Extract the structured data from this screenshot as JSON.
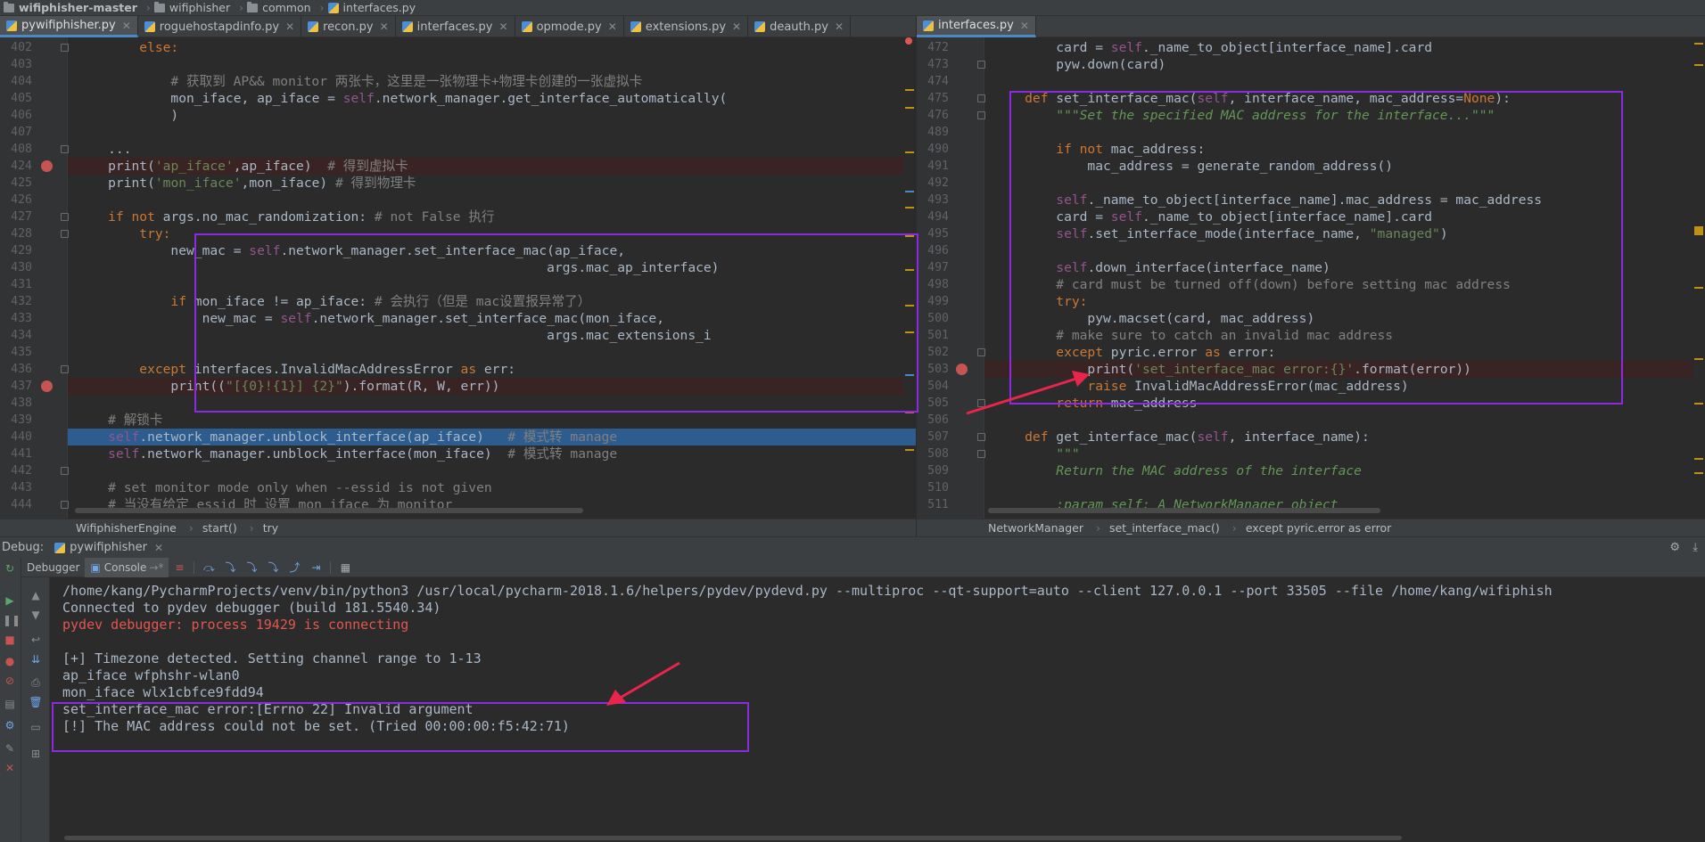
{
  "breadcrumb": [
    "wifiphisher-master",
    "wifiphisher",
    "common",
    "interfaces.py"
  ],
  "left_tabs": [
    {
      "label": "pywifiphisher.py",
      "active": true
    },
    {
      "label": "roguehostapdinfo.py",
      "active": false
    },
    {
      "label": "recon.py",
      "active": false
    },
    {
      "label": "interfaces.py",
      "active": false
    },
    {
      "label": "opmode.py",
      "active": false
    },
    {
      "label": "extensions.py",
      "active": false
    },
    {
      "label": "deauth.py",
      "active": false
    }
  ],
  "right_tabs": [
    {
      "label": "interfaces.py",
      "active": true
    }
  ],
  "left_editor": {
    "lines": [
      {
        "n": "402",
        "tokens": [
          {
            "t": "        else:",
            "c": "kw"
          }
        ]
      },
      {
        "n": "403",
        "tokens": [
          {
            "t": "",
            "c": ""
          }
        ]
      },
      {
        "n": "404",
        "tokens": [
          {
            "t": "            # 获取到 AP&& monitor 两张卡，这里是一张物理卡+物理卡创建的一张虚拟卡",
            "c": "cm"
          }
        ]
      },
      {
        "n": "405",
        "tokens": [
          {
            "t": "            mon_iface, ap_iface = ",
            "c": ""
          },
          {
            "t": "self",
            "c": "self"
          },
          {
            "t": ".network_manager.get_interface_automatically(",
            "c": ""
          }
        ]
      },
      {
        "n": "406",
        "tokens": [
          {
            "t": "            )",
            "c": ""
          }
        ]
      },
      {
        "n": "407",
        "tokens": [
          {
            "t": "",
            "c": ""
          }
        ]
      },
      {
        "n": "408",
        "tokens": [
          {
            "t": "    ...",
            "c": ""
          }
        ]
      },
      {
        "n": "424",
        "tokens": [
          {
            "t": "    print(",
            "c": ""
          },
          {
            "t": "'ap_iface'",
            "c": "str"
          },
          {
            "t": ",ap_iface)  ",
            "c": ""
          },
          {
            "t": "# 得到虚拟卡",
            "c": "cm"
          }
        ]
      },
      {
        "n": "425",
        "tokens": [
          {
            "t": "    print(",
            "c": ""
          },
          {
            "t": "'mon_iface'",
            "c": "str"
          },
          {
            "t": ",mon_iface) ",
            "c": ""
          },
          {
            "t": "# 得到物理卡",
            "c": "cm"
          }
        ]
      },
      {
        "n": "426",
        "tokens": [
          {
            "t": "",
            "c": ""
          }
        ]
      },
      {
        "n": "427",
        "tokens": [
          {
            "t": "    if not ",
            "c": "kw"
          },
          {
            "t": "args.no_mac_randomization: ",
            "c": ""
          },
          {
            "t": "# not False 执行",
            "c": "cm"
          }
        ]
      },
      {
        "n": "428",
        "tokens": [
          {
            "t": "        try:",
            "c": "kw"
          }
        ]
      },
      {
        "n": "429",
        "tokens": [
          {
            "t": "            new_mac = ",
            "c": ""
          },
          {
            "t": "self",
            "c": "self"
          },
          {
            "t": ".network_manager.set_interface_mac(ap_iface,",
            "c": ""
          }
        ]
      },
      {
        "n": "430",
        "tokens": [
          {
            "t": "                                                            args.mac_ap_interface)",
            "c": ""
          }
        ]
      },
      {
        "n": "431",
        "tokens": [
          {
            "t": "",
            "c": ""
          }
        ]
      },
      {
        "n": "432",
        "tokens": [
          {
            "t": "            if ",
            "c": "kw"
          },
          {
            "t": "mon_iface != ap_iface: ",
            "c": ""
          },
          {
            "t": "# 会执行（但是 mac设置报异常了）",
            "c": "cm"
          }
        ]
      },
      {
        "n": "433",
        "tokens": [
          {
            "t": "                new_mac = ",
            "c": ""
          },
          {
            "t": "self",
            "c": "self"
          },
          {
            "t": ".network_manager.set_interface_mac(mon_iface,",
            "c": ""
          }
        ]
      },
      {
        "n": "434",
        "tokens": [
          {
            "t": "                                                            args.mac_extensions_i",
            "c": ""
          }
        ]
      },
      {
        "n": "435",
        "tokens": [
          {
            "t": "",
            "c": ""
          }
        ]
      },
      {
        "n": "436",
        "tokens": [
          {
            "t": "        except ",
            "c": "kw"
          },
          {
            "t": "interfaces.InvalidMacAddressError ",
            "c": ""
          },
          {
            "t": "as ",
            "c": "kw"
          },
          {
            "t": "err:",
            "c": ""
          }
        ]
      },
      {
        "n": "437",
        "tokens": [
          {
            "t": "            print((",
            "c": ""
          },
          {
            "t": "\"[{0}!{1}] {2}\"",
            "c": "str"
          },
          {
            "t": ").format(R, W, err))",
            "c": ""
          }
        ]
      },
      {
        "n": "438",
        "tokens": [
          {
            "t": "",
            "c": ""
          }
        ]
      },
      {
        "n": "439",
        "tokens": [
          {
            "t": "    # 解锁卡",
            "c": "cm"
          }
        ]
      },
      {
        "n": "440",
        "tokens": [
          {
            "t": "    ",
            "c": ""
          },
          {
            "t": "self",
            "c": "self"
          },
          {
            "t": ".network_manager.unblock_interface(ap_iface)   ",
            "c": ""
          },
          {
            "t": "# 模式转 manage",
            "c": "cm"
          }
        ]
      },
      {
        "n": "441",
        "tokens": [
          {
            "t": "    ",
            "c": ""
          },
          {
            "t": "self",
            "c": "self"
          },
          {
            "t": ".network_manager.unblock_interface(mon_iface)  ",
            "c": ""
          },
          {
            "t": "# 模式转 manage",
            "c": "cm"
          }
        ]
      },
      {
        "n": "442",
        "tokens": [
          {
            "t": "",
            "c": ""
          }
        ]
      },
      {
        "n": "443",
        "tokens": [
          {
            "t": "    # set monitor mode only when --essid is not given",
            "c": "cm"
          }
        ]
      },
      {
        "n": "444",
        "tokens": [
          {
            "t": "    # 当没有给定 essid 时 设置 mon_iface 为 monitor",
            "c": "cm"
          }
        ]
      }
    ]
  },
  "right_editor": {
    "lines": [
      {
        "n": "472",
        "tokens": [
          {
            "t": "        card = ",
            "c": ""
          },
          {
            "t": "self",
            "c": "self"
          },
          {
            "t": "._name_to_object[interface_name].card",
            "c": ""
          }
        ]
      },
      {
        "n": "473",
        "tokens": [
          {
            "t": "        pyw.down(card)",
            "c": ""
          }
        ]
      },
      {
        "n": "474",
        "tokens": [
          {
            "t": "",
            "c": ""
          }
        ]
      },
      {
        "n": "475",
        "tokens": [
          {
            "t": "    def ",
            "c": "kw"
          },
          {
            "t": "set_interface_mac(",
            "c": ""
          },
          {
            "t": "self",
            "c": "self"
          },
          {
            "t": ", interface_name, mac_address=",
            "c": ""
          },
          {
            "t": "None",
            "c": "kw"
          },
          {
            "t": "):",
            "c": ""
          }
        ]
      },
      {
        "n": "476",
        "tokens": [
          {
            "t": "        \"\"\"Set the specified MAC address for the interface...\"\"\"",
            "c": "doc"
          }
        ]
      },
      {
        "n": "489",
        "tokens": [
          {
            "t": "",
            "c": ""
          }
        ]
      },
      {
        "n": "490",
        "tokens": [
          {
            "t": "        if not ",
            "c": "kw"
          },
          {
            "t": "mac_address:",
            "c": ""
          }
        ]
      },
      {
        "n": "491",
        "tokens": [
          {
            "t": "            mac_address = generate_random_address()",
            "c": ""
          }
        ]
      },
      {
        "n": "492",
        "tokens": [
          {
            "t": "",
            "c": ""
          }
        ]
      },
      {
        "n": "493",
        "tokens": [
          {
            "t": "        ",
            "c": ""
          },
          {
            "t": "self",
            "c": "self"
          },
          {
            "t": "._name_to_object[interface_name].mac_address = mac_address",
            "c": ""
          }
        ]
      },
      {
        "n": "494",
        "tokens": [
          {
            "t": "        card = ",
            "c": ""
          },
          {
            "t": "self",
            "c": "self"
          },
          {
            "t": "._name_to_object[interface_name].card",
            "c": ""
          }
        ]
      },
      {
        "n": "495",
        "tokens": [
          {
            "t": "        ",
            "c": ""
          },
          {
            "t": "self",
            "c": "self"
          },
          {
            "t": ".set_interface_mode(interface_name, ",
            "c": ""
          },
          {
            "t": "\"managed\"",
            "c": "str"
          },
          {
            "t": ")",
            "c": ""
          }
        ]
      },
      {
        "n": "496",
        "tokens": [
          {
            "t": "",
            "c": ""
          }
        ]
      },
      {
        "n": "497",
        "tokens": [
          {
            "t": "        ",
            "c": ""
          },
          {
            "t": "self",
            "c": "self"
          },
          {
            "t": ".down_interface(interface_name)",
            "c": ""
          }
        ]
      },
      {
        "n": "498",
        "tokens": [
          {
            "t": "        # card must be turned off(down) before setting mac address",
            "c": "cm"
          }
        ]
      },
      {
        "n": "499",
        "tokens": [
          {
            "t": "        try:",
            "c": "kw"
          }
        ]
      },
      {
        "n": "500",
        "tokens": [
          {
            "t": "            pyw.macset(card, mac_address)",
            "c": ""
          }
        ]
      },
      {
        "n": "501",
        "tokens": [
          {
            "t": "        # make sure to catch an invalid mac address",
            "c": "cm"
          }
        ]
      },
      {
        "n": "502",
        "tokens": [
          {
            "t": "        except ",
            "c": "kw"
          },
          {
            "t": "pyric.error ",
            "c": ""
          },
          {
            "t": "as ",
            "c": "kw"
          },
          {
            "t": "error:",
            "c": ""
          }
        ]
      },
      {
        "n": "503",
        "tokens": [
          {
            "t": "            print(",
            "c": ""
          },
          {
            "t": "'set_interface_mac error:{}'",
            "c": "str"
          },
          {
            "t": ".format(error))",
            "c": ""
          }
        ]
      },
      {
        "n": "504",
        "tokens": [
          {
            "t": "            raise ",
            "c": "kw"
          },
          {
            "t": "InvalidMacAddressError(mac_address)",
            "c": ""
          }
        ]
      },
      {
        "n": "505",
        "tokens": [
          {
            "t": "        return ",
            "c": "kw"
          },
          {
            "t": "mac_address",
            "c": ""
          }
        ]
      },
      {
        "n": "506",
        "tokens": [
          {
            "t": "",
            "c": ""
          }
        ]
      },
      {
        "n": "507",
        "tokens": [
          {
            "t": "    def ",
            "c": "kw"
          },
          {
            "t": "get_interface_mac(",
            "c": ""
          },
          {
            "t": "self",
            "c": "self"
          },
          {
            "t": ", interface_name):",
            "c": ""
          }
        ]
      },
      {
        "n": "508",
        "tokens": [
          {
            "t": "        \"\"\"",
            "c": "doc"
          }
        ]
      },
      {
        "n": "509",
        "tokens": [
          {
            "t": "        Return the MAC address of the interface",
            "c": "doc"
          }
        ]
      },
      {
        "n": "510",
        "tokens": [
          {
            "t": "",
            "c": ""
          }
        ]
      },
      {
        "n": "511",
        "tokens": [
          {
            "t": "        :param self: A NetworkManager object",
            "c": "doc"
          }
        ]
      }
    ]
  },
  "left_crumbs": [
    "WifiphisherEngine",
    "start()",
    "try"
  ],
  "right_crumbs": [
    "NetworkManager",
    "set_interface_mac()",
    "except pyric.error as error"
  ],
  "debug": {
    "label": "Debug:",
    "session": "pywifiphisher",
    "tabs": [
      "Debugger",
      "Console"
    ]
  },
  "console": [
    {
      "text": "/home/kang/PycharmProjects/venv/bin/python3 /usr/local/pycharm-2018.1.6/helpers/pydev/pydevd.py --multiproc --qt-support=auto --client 127.0.0.1 --port 33505 --file /home/kang/wifiphish",
      "color": "#a9b7c6"
    },
    {
      "text": "Connected to pydev debugger (build 181.5540.34)",
      "color": "#a9b7c6"
    },
    {
      "text": "pydev debugger: process 19429 is connecting",
      "color": "#e0574f"
    },
    {
      "text": "",
      "color": "#a9b7c6"
    },
    {
      "text": "[+] Timezone detected. Setting channel range to 1-13",
      "color": "#a9b7c6"
    },
    {
      "text": "ap_iface wfphshr-wlan0",
      "color": "#a9b7c6"
    },
    {
      "text": "mon_iface wlx1cbfce9fdd94",
      "color": "#a9b7c6"
    },
    {
      "text": "set_interface_mac error:[Errno 22] Invalid argument",
      "color": "#a9b7c6"
    },
    {
      "text": "[!] The MAC address could not be set. (Tried 00:00:00:f5:42:71)",
      "color": "#a9b7c6"
    }
  ],
  "colors": {
    "annotation_box": "#8a2be2",
    "arrow": "#e8254a",
    "breakpoint": "#c75450",
    "current_line": "#2d5c8f"
  }
}
